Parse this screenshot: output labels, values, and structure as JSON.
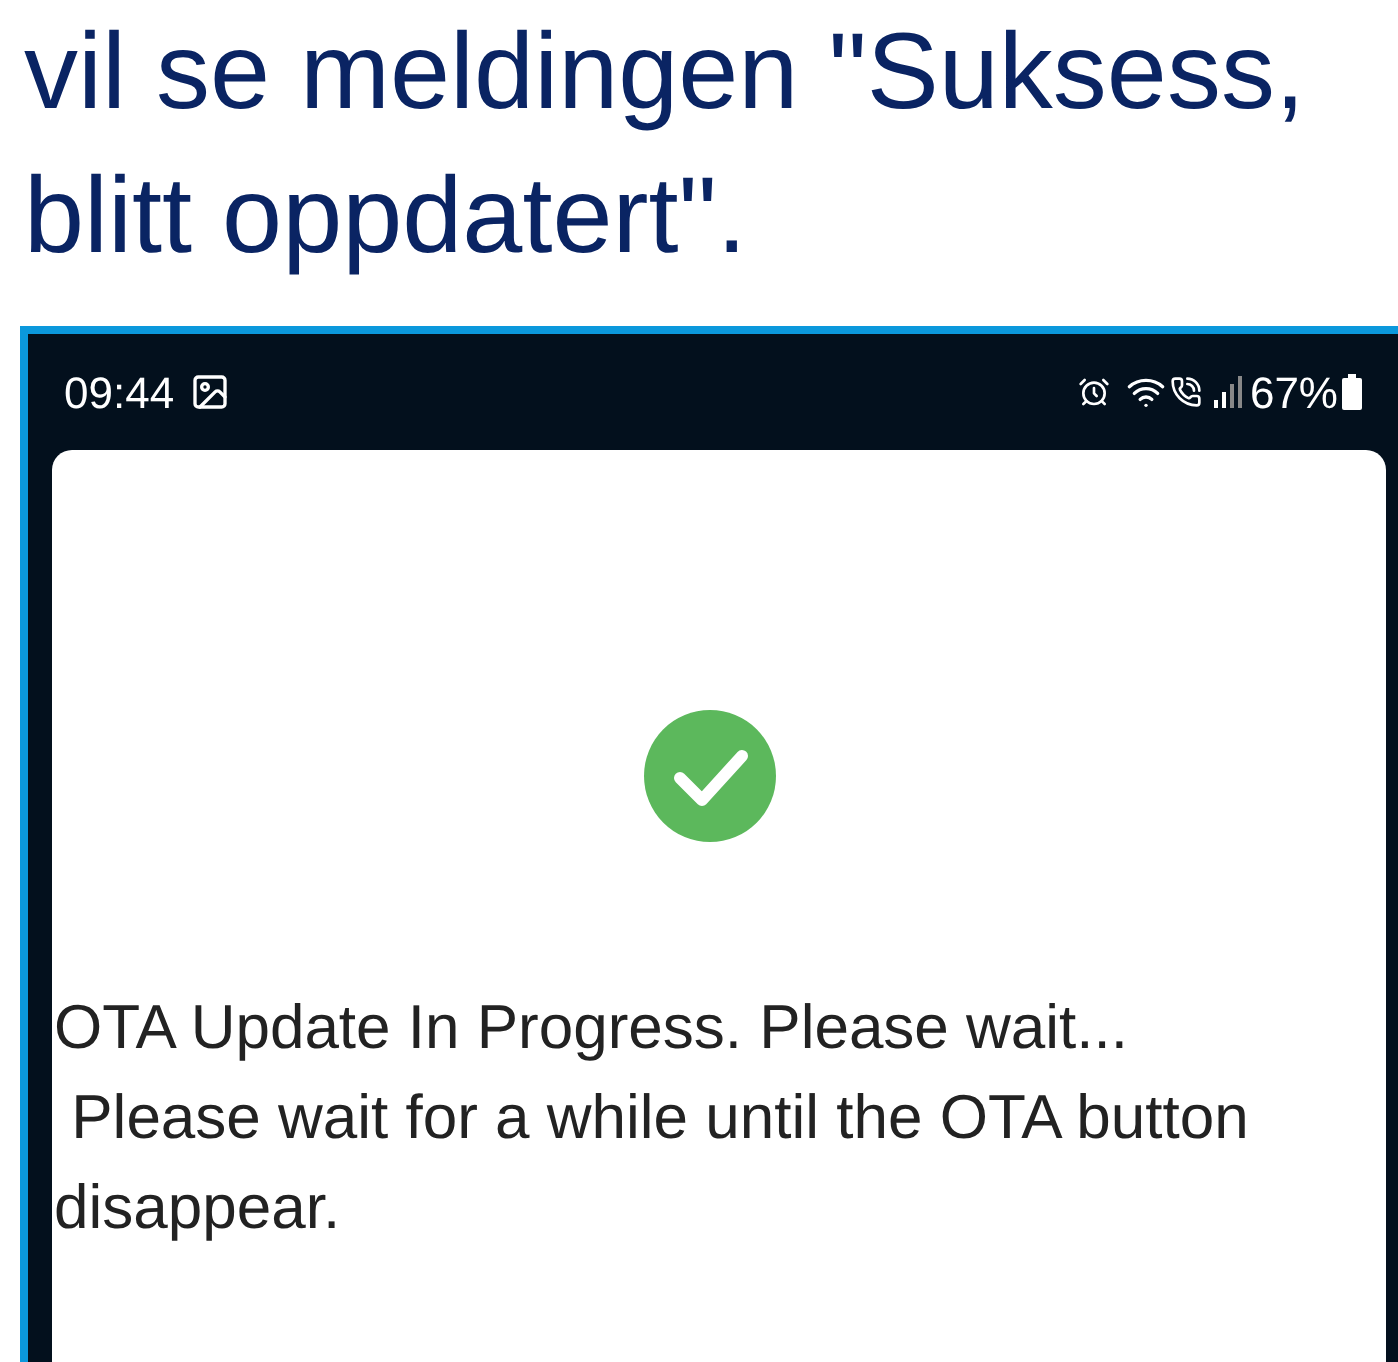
{
  "article_text": [
    "vil se meldingen \"Suksess,",
    "blitt oppdatert\"."
  ],
  "phone": {
    "status_bar": {
      "time": "09:44",
      "battery": "67%"
    },
    "dialog": {
      "kind": "success",
      "title": "OTA Update In Progress. Please wait...",
      "message": " Please wait for a while until the OTA button disappear."
    }
  }
}
